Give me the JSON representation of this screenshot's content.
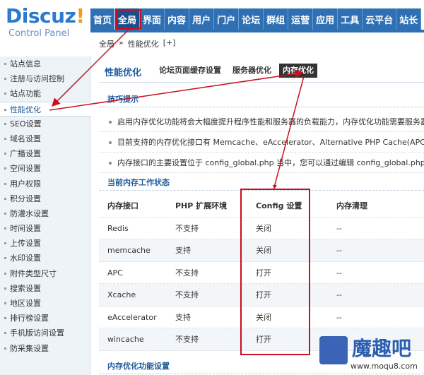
{
  "logo": {
    "main": "Discuz",
    "excl": "!",
    "sub": "Control Panel"
  },
  "nav": [
    {
      "label": "首页"
    },
    {
      "label": "全局",
      "active": true
    },
    {
      "label": "界面"
    },
    {
      "label": "内容"
    },
    {
      "label": "用户"
    },
    {
      "label": "门户"
    },
    {
      "label": "论坛"
    },
    {
      "label": "群组"
    },
    {
      "label": "运营"
    },
    {
      "label": "应用"
    },
    {
      "label": "工具"
    },
    {
      "label": "云平台"
    },
    {
      "label": "站长"
    }
  ],
  "breadcrumb": {
    "root": "全局",
    "sep": "»",
    "current": "性能优化",
    "add": "[+]"
  },
  "sidebar": [
    "站点信息",
    "注册与访问控制",
    "站点功能",
    "性能优化",
    "SEO设置",
    "域名设置",
    "广播设置",
    "空间设置",
    "用户权限",
    "积分设置",
    "防灌水设置",
    "时间设置",
    "上传设置",
    "水印设置",
    "附件类型尺寸",
    "搜索设置",
    "地区设置",
    "排行榜设置",
    "手机版访问设置",
    "防采集设置"
  ],
  "sidebar_active_index": 3,
  "main": {
    "title": "性能优化",
    "subtabs": [
      {
        "label": "论坛页面缓存设置"
      },
      {
        "label": "服务器优化"
      },
      {
        "label": "内存优化",
        "active": true
      }
    ],
    "tips_title": "技巧提示",
    "tips": [
      "启用内存优化功能将会大幅度提升程序性能和服务器的负载能力，内存优化功能需要服务器系",
      "目前支持的内存优化接口有 Memcache、eAccelerator、Alternative PHP Cache(APC)",
      "内存接口的主要设置位于 config_global.php 当中，您可以通过编辑 config_global.php"
    ],
    "status_title": "当前内存工作状态",
    "table": {
      "headers": [
        "内存接口",
        "PHP 扩展环境",
        "Config 设置",
        "内存清理"
      ],
      "rows": [
        [
          "Redis",
          "不支持",
          "关闭",
          "--"
        ],
        [
          "memcache",
          "支持",
          "关闭",
          "--"
        ],
        [
          "APC",
          "不支持",
          "打开",
          "--"
        ],
        [
          "Xcache",
          "不支持",
          "打开",
          "--"
        ],
        [
          "eAccelerator",
          "支持",
          "关闭",
          "--"
        ],
        [
          "wincache",
          "不支持",
          "打开",
          "--"
        ]
      ]
    },
    "settings_title": "内存优化功能设置"
  },
  "watermark": {
    "text": "魔趣吧",
    "url": "www.moqu8.com",
    "small": "MOQU8.COM"
  },
  "colors": {
    "nav_bg": "#2f6fb3",
    "accent": "#1e5a9c",
    "annotation_red": "#c8101e"
  }
}
